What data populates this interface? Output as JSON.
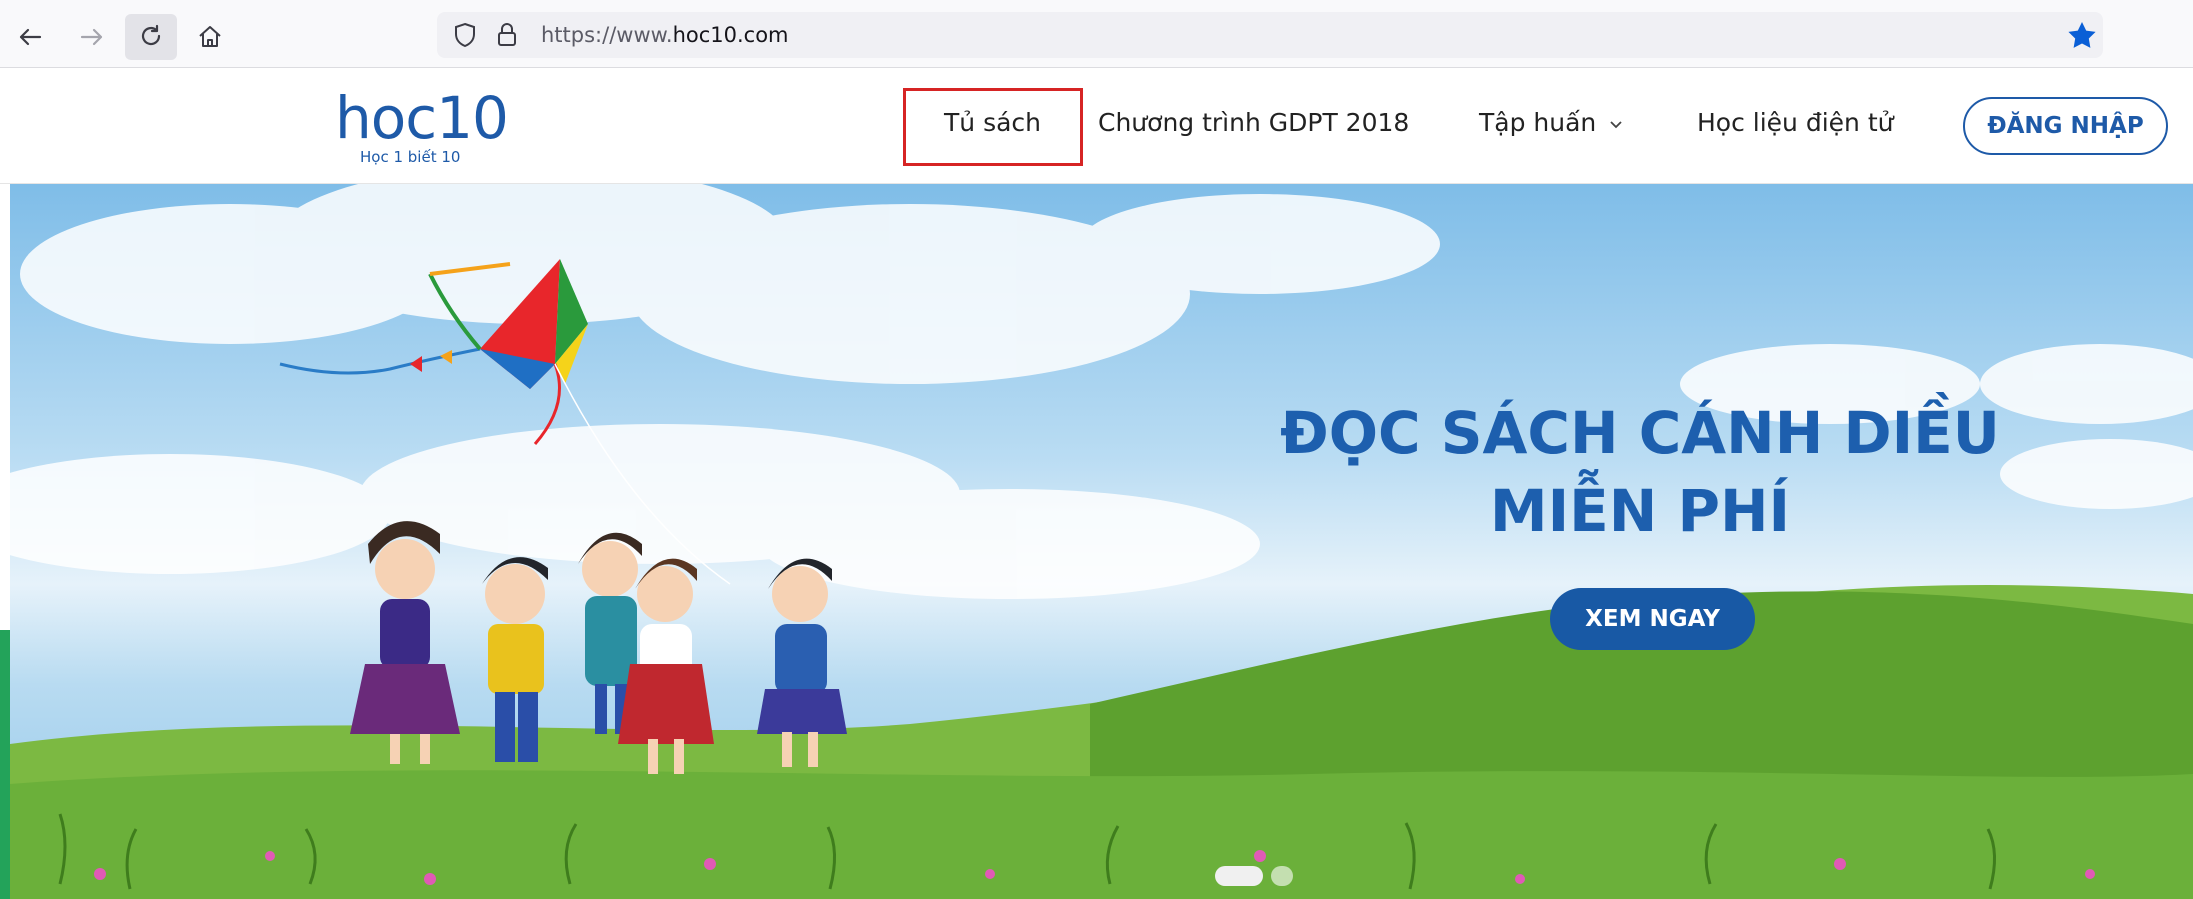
{
  "browser": {
    "url_prefix": "https://www.",
    "url_domain": "hoc10.com",
    "icons": [
      "back-arrow-icon",
      "forward-arrow-icon",
      "reload-icon",
      "home-icon",
      "shield-icon",
      "lock-icon",
      "bookmark-star-icon"
    ]
  },
  "site": {
    "logo_text": "hoc10",
    "logo_tagline": "Học 1 biết 10",
    "nav": {
      "item1": "Tủ sách",
      "item2": "Chương trình GDPT 2018",
      "item3": "Tập huấn",
      "item4": "Học liệu điện tử"
    },
    "login_label": "ĐĂNG NHẬP",
    "brand_color": "#1e5aa8",
    "highlight_color": "#d62424"
  },
  "hero": {
    "title_line1": "ĐỌC SÁCH CÁNH DIỀU",
    "title_line2": "MIỄN PHÍ",
    "cta_label": "XEM NGAY",
    "slides": 2,
    "active_slide": 1
  }
}
